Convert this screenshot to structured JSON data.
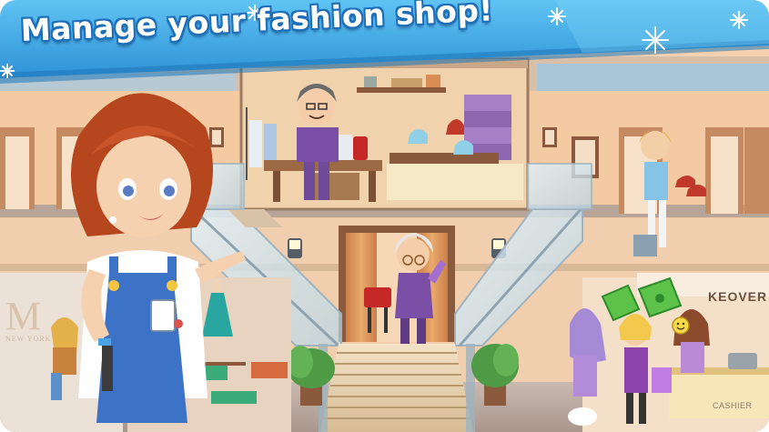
{
  "banner": {
    "title": "Manage your fashion shop!"
  },
  "signs": {
    "makeover": "KEOVER",
    "cashier": "CASHIER",
    "boutique_city": "NEW YORK",
    "boutique_letter": "M"
  },
  "colors": {
    "banner_blue": "#3fa9e6",
    "title_outline": "#1e6fb8",
    "mall_wall": "#f0c9a4",
    "stair_glass": "#cfe3ee",
    "currency_green": "#5cc24a"
  },
  "icons": {
    "snowflakes": "snowflake-icon",
    "cash_reward": "cash-bill-icon",
    "happy_customer": "smiley-icon"
  }
}
